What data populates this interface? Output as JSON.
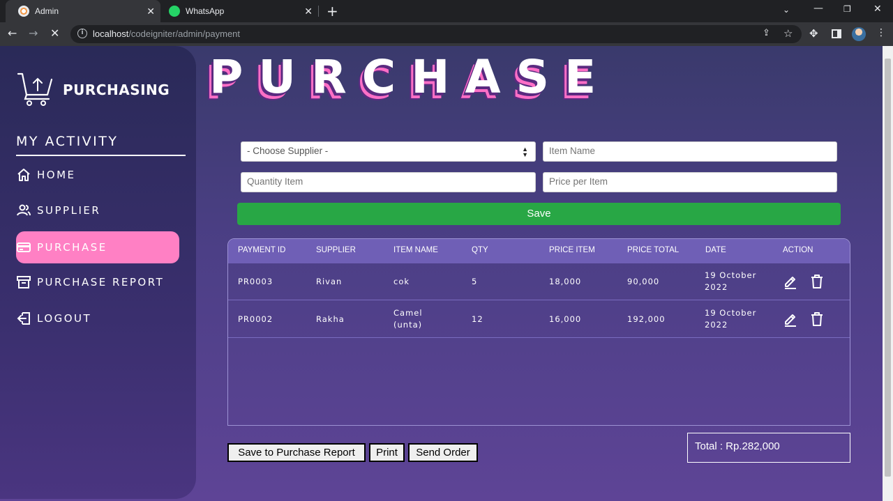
{
  "browser": {
    "tabs": [
      {
        "title": "Admin",
        "close": "✕"
      },
      {
        "title": "WhatsApp",
        "close": "✕"
      }
    ],
    "new_tab": "+",
    "url_host": "localhost",
    "url_path": "/codeigniter/admin/payment"
  },
  "sidebar": {
    "brand": "PURCHASING",
    "section_title": "MY ACTIVITY",
    "items": [
      {
        "label": "HOME",
        "icon": "home-icon"
      },
      {
        "label": "SUPPLIER",
        "icon": "users-icon"
      },
      {
        "label": "PURCHASE",
        "icon": "credit-card-icon",
        "active": true
      },
      {
        "label": "PURCHASE REPORT",
        "icon": "archive-icon"
      },
      {
        "label": "LOGOUT",
        "icon": "logout-icon"
      }
    ]
  },
  "hero_title": "PURCHASE",
  "form": {
    "supplier_placeholder": "- Choose Supplier -",
    "item_name_placeholder": "Item Name",
    "quantity_placeholder": "Quantity Item",
    "price_placeholder": "Price per Item",
    "save_label": "Save"
  },
  "table": {
    "headers": [
      "PAYMENT ID",
      "SUPPLIER",
      "ITEM NAME",
      "QTY",
      "PRICE ITEM",
      "PRICE TOTAL",
      "DATE",
      "ACTION"
    ],
    "rows": [
      {
        "payment_id": "PR0003",
        "supplier": "Rivan",
        "item_name": "cok",
        "qty": "5",
        "price_item": "18,000",
        "price_total": "90,000",
        "date": "19 October 2022"
      },
      {
        "payment_id": "PR0002",
        "supplier": "Rakha",
        "item_name": "Camel (unta)",
        "qty": "12",
        "price_item": "16,000",
        "price_total": "192,000",
        "date": "19 October 2022"
      }
    ]
  },
  "footer": {
    "save_report_label": "Save to Purchase Report",
    "print_label": "Print",
    "send_order_label": "Send Order",
    "total_label": "Total : Rp.282,000"
  },
  "colors": {
    "accent_pink": "#ff80c4",
    "save_green": "#28a745",
    "table_header": "#6f5fb6"
  }
}
